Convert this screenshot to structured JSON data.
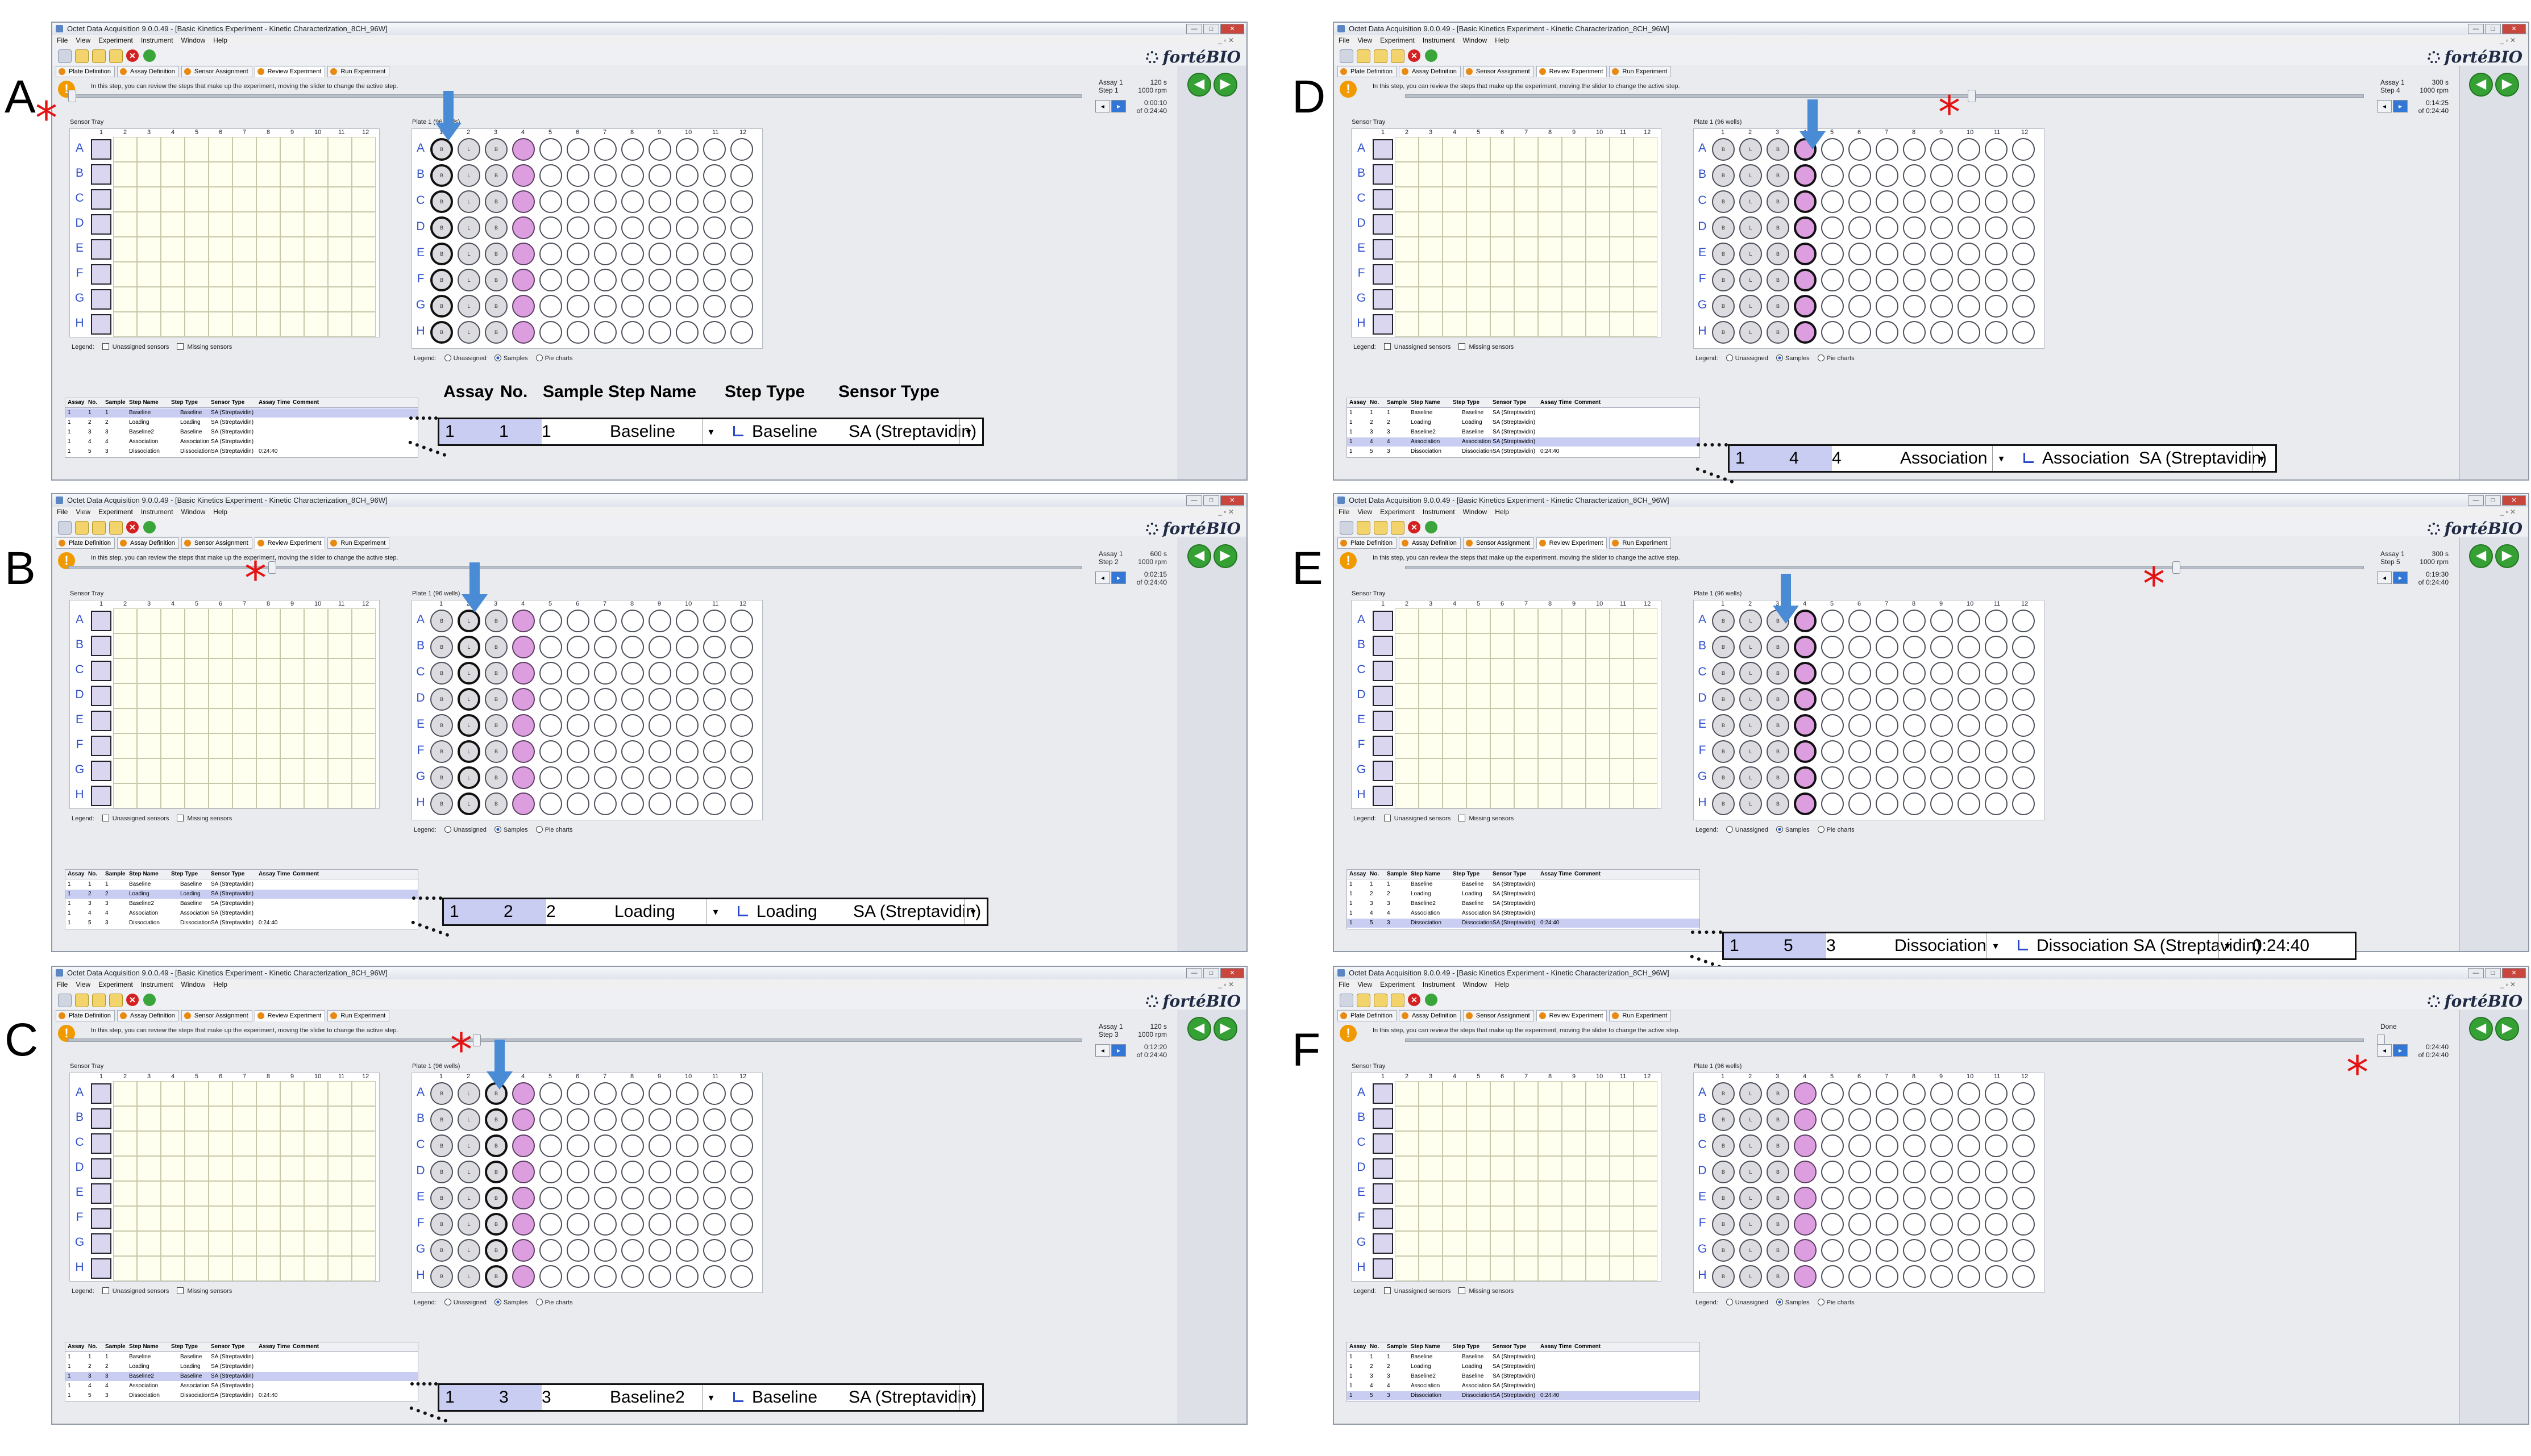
{
  "app": {
    "title": "Octet Data Acquisition 9.0.0.49 - [Basic Kinetics Experiment - Kinetic Characterization_8CH_96W]",
    "menu": [
      "File",
      "View",
      "Experiment",
      "Instrument",
      "Window",
      "Help"
    ],
    "logo": "fortéBIO",
    "tabs": [
      "Plate Definition",
      "Assay Definition",
      "Sensor Assignment",
      "Review Experiment",
      "Run Experiment"
    ],
    "info": "In this step, you can review the steps that make up the experiment, moving the slider to change the active step.",
    "sensor_tray_title": "Sensor Tray",
    "plate_title": "Plate 1 (96 wells)",
    "legend_label": "Legend:",
    "legend_sensor_unassigned": "Unassigned sensors",
    "legend_sensor_missing": "Missing sensors",
    "legend_plate_unassigned": "Unassigned",
    "legend_plate_samples": "Samples",
    "legend_plate_pie": "Pie charts",
    "rows": [
      "A",
      "B",
      "C",
      "D",
      "E",
      "F",
      "G",
      "H"
    ],
    "cols": [
      "1",
      "2",
      "3",
      "4",
      "5",
      "6",
      "7",
      "8",
      "9",
      "10",
      "11",
      "12"
    ],
    "well_letters": [
      "B",
      "L",
      "B"
    ],
    "table_headers": [
      "Assay",
      "No.",
      "Sample",
      "Step Name",
      "Step Type",
      "Sensor Type",
      "Assay Time",
      "Comment"
    ],
    "table_rows": [
      {
        "assay": "1",
        "no": "1",
        "sample": "1",
        "name": "Baseline",
        "type": "Baseline",
        "sensor": "SA (Streptavidin)",
        "time": ""
      },
      {
        "assay": "1",
        "no": "2",
        "sample": "2",
        "name": "Loading",
        "type": "Loading",
        "sensor": "SA (Streptavidin)",
        "time": ""
      },
      {
        "assay": "1",
        "no": "3",
        "sample": "3",
        "name": "Baseline2",
        "type": "Baseline",
        "sensor": "SA (Streptavidin)",
        "time": ""
      },
      {
        "assay": "1",
        "no": "4",
        "sample": "4",
        "name": "Association",
        "type": "Association",
        "sensor": "SA (Streptavidin)",
        "time": ""
      },
      {
        "assay": "1",
        "no": "5",
        "sample": "3",
        "name": "Dissociation",
        "type": "Dissociation",
        "sensor": "SA (Streptavidin)",
        "time": "0:24:40"
      }
    ]
  },
  "panels": [
    {
      "letter": "A",
      "assay": "Assay 1",
      "step": "Step 1",
      "speed": "120 s",
      "rpm": "1000 rpm",
      "elapsed": "0:00:10",
      "total": "of 0:24:40",
      "sel": 0,
      "zoom": {
        "assay": "1",
        "no": "1",
        "sample": "1",
        "name": "Baseline",
        "type": "Baseline",
        "sensor": "SA (Streptavidin)",
        "time": ""
      }
    },
    {
      "letter": "B",
      "assay": "Assay 1",
      "step": "Step 2",
      "speed": "600 s",
      "rpm": "1000 rpm",
      "elapsed": "0:02:15",
      "total": "of 0:24:40",
      "sel": 1,
      "zoom": {
        "assay": "1",
        "no": "2",
        "sample": "2",
        "name": "Loading",
        "type": "Loading",
        "sensor": "SA (Streptavidin)",
        "time": ""
      }
    },
    {
      "letter": "C",
      "assay": "Assay 1",
      "step": "Step 3",
      "speed": "120 s",
      "rpm": "1000 rpm",
      "elapsed": "0:12:20",
      "total": "of 0:24:40",
      "sel": 2,
      "zoom": {
        "assay": "1",
        "no": "3",
        "sample": "3",
        "name": "Baseline2",
        "type": "Baseline",
        "sensor": "SA (Streptavidin)",
        "time": ""
      }
    },
    {
      "letter": "D",
      "assay": "Assay 1",
      "step": "Step 4",
      "speed": "300 s",
      "rpm": "1000 rpm",
      "elapsed": "0:14:25",
      "total": "of 0:24:40",
      "sel": 3,
      "zoom": {
        "assay": "1",
        "no": "4",
        "sample": "4",
        "name": "Association",
        "type": "Association",
        "sensor": "SA (Streptavidin)",
        "time": ""
      }
    },
    {
      "letter": "E",
      "assay": "Assay 1",
      "step": "Step 5",
      "speed": "300 s",
      "rpm": "1000 rpm",
      "elapsed": "0:19:30",
      "total": "of 0:24:40",
      "sel": 4,
      "zoom": {
        "assay": "1",
        "no": "5",
        "sample": "3",
        "name": "Dissociation",
        "type": "Dissociation",
        "sensor": "SA (Streptavidin)",
        "time": "0:24:40"
      }
    },
    {
      "letter": "F",
      "assay": "Done",
      "step": "",
      "speed": "",
      "rpm": "",
      "elapsed": "0:24:40",
      "total": "of 0:24:40",
      "sel": 4,
      "zoom": null
    }
  ],
  "zoom_headers": [
    "Assay",
    "No.",
    "Sample",
    "Step Name",
    "Step Type",
    "Sensor Type"
  ],
  "colors": {
    "sample_well": "#dd9ee0",
    "arrow": "#4a8bd6",
    "star": "#e51212",
    "selection": "#c9cdf2",
    "row_label": "#2e4fcc"
  }
}
